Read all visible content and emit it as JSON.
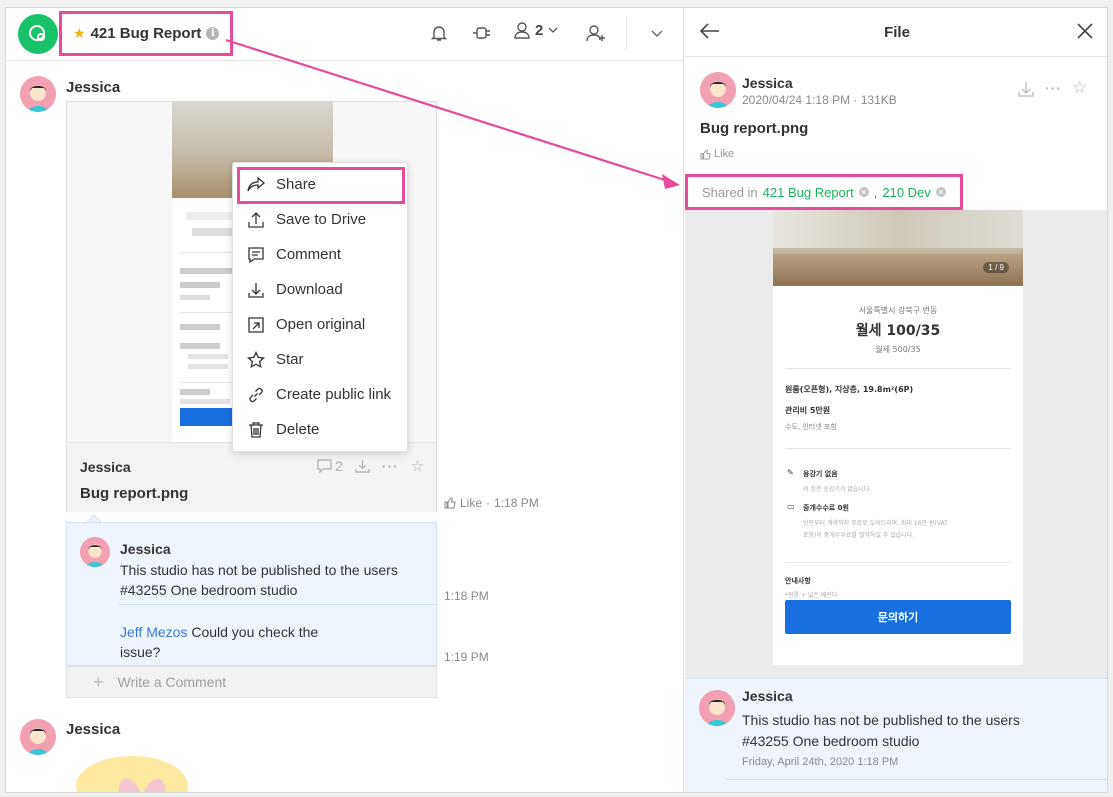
{
  "header": {
    "channel_title": "421 Bug Report",
    "member_count": "2"
  },
  "messages": [
    {
      "sender": "Jessica",
      "file": {
        "uploader": "Jessica",
        "filename": "Bug report.png",
        "comment_count": "2"
      },
      "like_label": "Like",
      "time": "1:18 PM"
    },
    {
      "sender": "Jessica"
    }
  ],
  "context_menu": {
    "items": [
      {
        "label": "Share",
        "icon": "share-icon"
      },
      {
        "label": "Save to Drive",
        "icon": "upload-icon"
      },
      {
        "label": "Comment",
        "icon": "comment-icon"
      },
      {
        "label": "Download",
        "icon": "download-icon"
      },
      {
        "label": "Open original",
        "icon": "open-external-icon"
      },
      {
        "label": "Star",
        "icon": "star-icon"
      },
      {
        "label": "Create public link",
        "icon": "link-icon"
      },
      {
        "label": "Delete",
        "icon": "trash-icon"
      }
    ]
  },
  "comments": [
    {
      "sender": "Jessica",
      "text_line1": "This studio has not be published to the users",
      "text_line2": "#43255 One bedroom studio",
      "time": "1:18 PM"
    },
    {
      "mention": "Jeff Mezos",
      "text_line1": "Could you check the",
      "text_line2": "issue?",
      "time": "1:19 PM"
    }
  ],
  "write_comment_placeholder": "Write a Comment",
  "file_panel": {
    "title": "File",
    "uploader": "Jessica",
    "date_size": "2020/04/24 1:18 PM · 131KB",
    "filename": "Bug report.png",
    "like_label": "Like",
    "shared_in_label": "Shared in",
    "shared_channels": [
      "421 Bug Report",
      "210 Dev"
    ],
    "preview": {
      "photo_count": "1 / 9",
      "address": "서울특별시 강북구 번동",
      "price": "월세 100/35",
      "sub_price": "월세 500/35",
      "room_info": "원룸(오픈형), 지상층, 19.8m²(6P)",
      "maintenance": "관리비 5만원",
      "maintenance_detail": "수도, 인터넷 포함",
      "loan_title": "융강기 없음",
      "loan_detail": "이 집은 승강기가 없습니다.",
      "fee_title": "중개수수료 0원",
      "fee_detail_1": "방문부터 계약까지 무료로 도와드리며, 최대 16만 원(VAT",
      "fee_detail_2": "포함)의 중개수수료를 절약하실 수 있습니다.",
      "notice_title": "안내사항",
      "notice_detail": "*원룸 + 넓은 베란다",
      "contact_button": "문의하기"
    },
    "comment": {
      "sender": "Jessica",
      "text_line1": "This studio has not be published to the users",
      "text_line2": "#43255 One bedroom studio",
      "time": "Friday, April 24th, 2020  1:18 PM"
    }
  },
  "colors": {
    "highlight": "#e64c9b",
    "brand_green": "#17c26a",
    "mention_blue": "#3b7ad8",
    "comment_bg": "#edf4fc",
    "primary_button": "#1a6fe0"
  }
}
